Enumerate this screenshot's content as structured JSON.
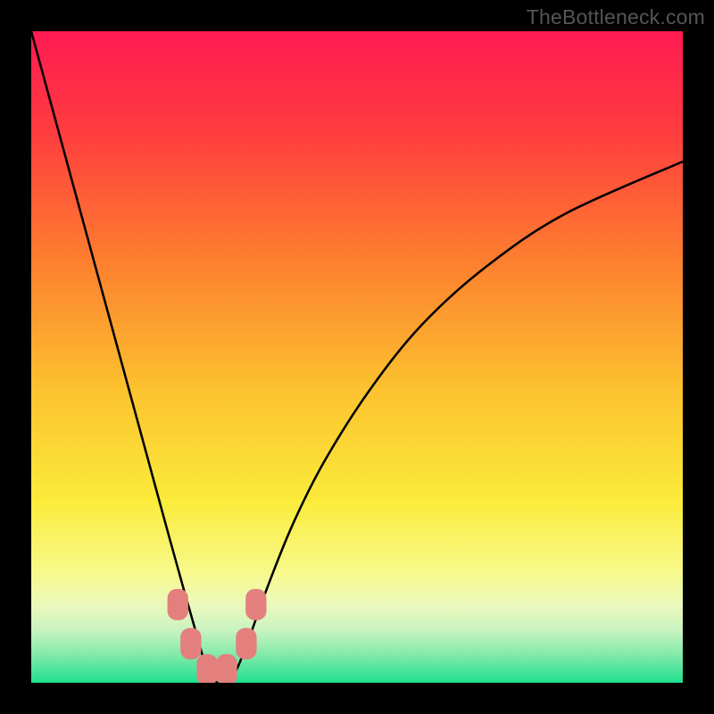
{
  "watermark": "TheBottleneck.com",
  "colors": {
    "bg_black": "#000000",
    "marker": "#e3807e",
    "curve": "#000000",
    "watermark_text": "#555555"
  },
  "chart_data": {
    "type": "line",
    "title": "",
    "xlabel": "",
    "ylabel": "",
    "xlim": [
      0,
      100
    ],
    "ylim": [
      0,
      100
    ],
    "grid": false,
    "legend": false,
    "gradient_stops": [
      {
        "pos": 0.0,
        "color": "#ff1a52"
      },
      {
        "pos": 0.15,
        "color": "#ff3b3f"
      },
      {
        "pos": 0.35,
        "color": "#fd7e2f"
      },
      {
        "pos": 0.55,
        "color": "#fcc22f"
      },
      {
        "pos": 0.72,
        "color": "#fbeb3a"
      },
      {
        "pos": 0.83,
        "color": "#f7f98a"
      },
      {
        "pos": 0.88,
        "color": "#ecf9bc"
      },
      {
        "pos": 0.92,
        "color": "#c8f3c0"
      },
      {
        "pos": 0.96,
        "color": "#7ce9a8"
      },
      {
        "pos": 1.0,
        "color": "#1fe08f"
      }
    ],
    "series": [
      {
        "name": "bottleneck-curve",
        "x": [
          0,
          3,
          6,
          9,
          12,
          15,
          18,
          21,
          23.5,
          25.5,
          27,
          28.5,
          30,
          31.5,
          33.5,
          36,
          40,
          45,
          52,
          60,
          70,
          82,
          100
        ],
        "y": [
          100,
          89,
          78,
          67,
          56,
          45,
          34,
          23,
          14,
          7,
          2,
          0,
          0,
          2,
          7,
          14,
          24,
          34,
          45,
          55,
          64,
          72,
          80
        ]
      }
    ],
    "markers": [
      {
        "x": 22.5,
        "y": 12
      },
      {
        "x": 24.5,
        "y": 6
      },
      {
        "x": 27.0,
        "y": 2
      },
      {
        "x": 30.0,
        "y": 2
      },
      {
        "x": 33.0,
        "y": 6
      },
      {
        "x": 34.5,
        "y": 12
      }
    ],
    "marker_shape": "rounded-rect",
    "marker_size": {
      "w": 3.2,
      "h": 4.8,
      "rx": 1.4
    }
  }
}
